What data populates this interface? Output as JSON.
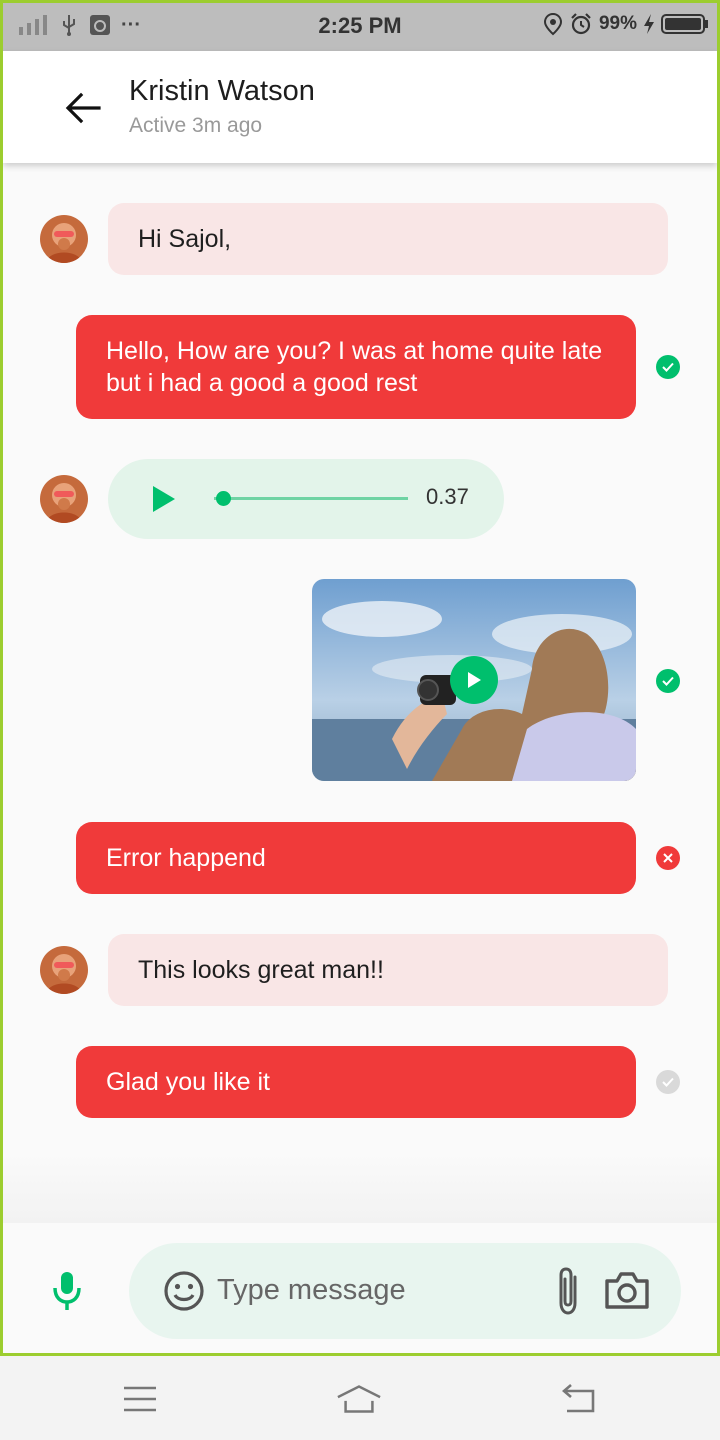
{
  "status_bar": {
    "time": "2:25 PM",
    "battery": "99%",
    "more": "···"
  },
  "header": {
    "name": "Kristin Watson",
    "status": "Active 3m ago"
  },
  "messages": [
    {
      "sender": "contact",
      "type": "text",
      "text": "Hi Sajol,"
    },
    {
      "sender": "me",
      "type": "text",
      "text": "Hello, How are you? I was at home quite late but i had a good a good rest",
      "status": "viewed"
    },
    {
      "sender": "contact",
      "type": "audio",
      "duration": "0.37",
      "progress": 0.04
    },
    {
      "sender": "me",
      "type": "video",
      "status": "viewed"
    },
    {
      "sender": "me",
      "type": "text",
      "text": "Error happend",
      "status": "error"
    },
    {
      "sender": "contact",
      "type": "text",
      "text": "This looks great man!!"
    },
    {
      "sender": "me",
      "type": "text",
      "text": "Glad you like it",
      "status": "sent"
    }
  ],
  "input": {
    "placeholder": "Type message"
  },
  "icons": {
    "back": "arrow-left-icon",
    "mic": "mic-icon",
    "emoji": "emoji-icon",
    "attach": "paperclip-icon",
    "camera": "camera-icon"
  },
  "colors": {
    "primary": "#00bf6d",
    "outgoing_bubble": "#f03a3a",
    "incoming_bubble": "#f9e6e6",
    "audio_bubble": "#e3f4ea",
    "error": "#f03a3a",
    "sent_gray": "#d9d9d9"
  }
}
